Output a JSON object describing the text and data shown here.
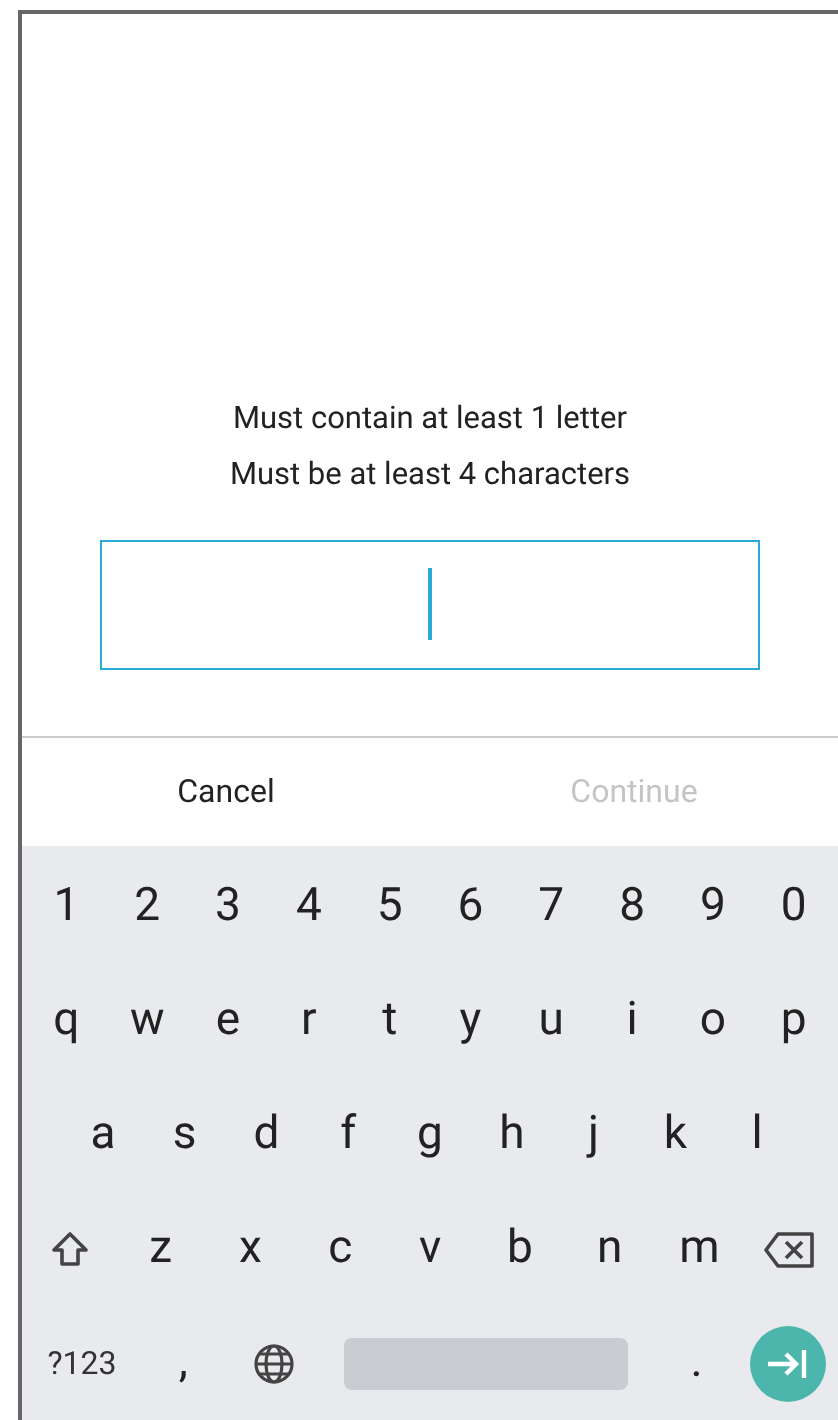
{
  "hints": [
    "Must contain at least 1 letter",
    "Must be at least 4 characters"
  ],
  "input": {
    "focused": true
  },
  "actions": [
    {
      "label": "Cancel",
      "disabled": false
    },
    {
      "label": "Continue",
      "disabled": true
    }
  ],
  "keyboard": {
    "rows": [
      [
        {
          "kind": "char",
          "label": "1"
        },
        {
          "kind": "char",
          "label": "2"
        },
        {
          "kind": "char",
          "label": "3"
        },
        {
          "kind": "char",
          "label": "4"
        },
        {
          "kind": "char",
          "label": "5"
        },
        {
          "kind": "char",
          "label": "6"
        },
        {
          "kind": "char",
          "label": "7"
        },
        {
          "kind": "char",
          "label": "8"
        },
        {
          "kind": "char",
          "label": "9"
        },
        {
          "kind": "char",
          "label": "0"
        }
      ],
      [
        {
          "kind": "char",
          "label": "q"
        },
        {
          "kind": "char",
          "label": "w"
        },
        {
          "kind": "char",
          "label": "e"
        },
        {
          "kind": "char",
          "label": "r"
        },
        {
          "kind": "char",
          "label": "t"
        },
        {
          "kind": "char",
          "label": "y"
        },
        {
          "kind": "char",
          "label": "u"
        },
        {
          "kind": "char",
          "label": "i"
        },
        {
          "kind": "char",
          "label": "o"
        },
        {
          "kind": "char",
          "label": "p"
        }
      ],
      [
        {
          "kind": "char",
          "label": "a"
        },
        {
          "kind": "char",
          "label": "s"
        },
        {
          "kind": "char",
          "label": "d"
        },
        {
          "kind": "char",
          "label": "f"
        },
        {
          "kind": "char",
          "label": "g"
        },
        {
          "kind": "char",
          "label": "h"
        },
        {
          "kind": "char",
          "label": "j"
        },
        {
          "kind": "char",
          "label": "k"
        },
        {
          "kind": "char",
          "label": "l"
        }
      ],
      [
        {
          "kind": "shift"
        },
        {
          "kind": "char",
          "label": "z"
        },
        {
          "kind": "char",
          "label": "x"
        },
        {
          "kind": "char",
          "label": "c"
        },
        {
          "kind": "char",
          "label": "v"
        },
        {
          "kind": "char",
          "label": "b"
        },
        {
          "kind": "char",
          "label": "n"
        },
        {
          "kind": "char",
          "label": "m"
        },
        {
          "kind": "backspace"
        }
      ],
      [
        {
          "kind": "symbols",
          "label": "?123"
        },
        {
          "kind": "char",
          "label": ","
        },
        {
          "kind": "globe"
        },
        {
          "kind": "space"
        },
        {
          "kind": "char",
          "label": "."
        },
        {
          "kind": "enter"
        }
      ]
    ]
  }
}
